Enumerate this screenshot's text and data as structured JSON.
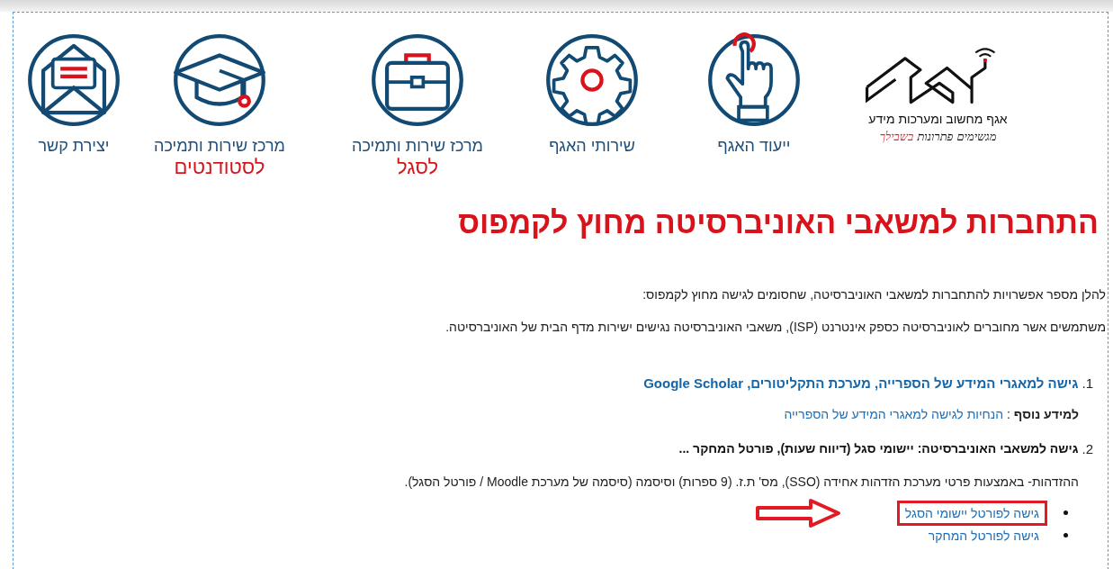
{
  "header": {
    "logo": {
      "name": "אגף מחשוב ומערכות מידע",
      "tagline": "מגשימים פתרונות",
      "tagline_highlight": "בשבילך"
    },
    "nav": [
      {
        "kind": "hand",
        "label": "ייעוד האגף"
      },
      {
        "kind": "gear",
        "label": "שירותי האגף"
      },
      {
        "kind": "briefcase",
        "label": "מרכז שירות ותמיכה",
        "sub": "לסגל"
      },
      {
        "kind": "cap",
        "label": "מרכז שירות ותמיכה",
        "sub": "לסטודנטים"
      },
      {
        "kind": "envelope",
        "label": "יצירת קשר"
      }
    ]
  },
  "title": "התחברות למשאבי האוניברסיטה מחוץ לקמפוס",
  "paragraphs": [
    "להלן מספר אפשרויות להתחברות למשאבי האוניברסיטה, שחסומים לגישה מחוץ לקמפוס:",
    "משתמשים אשר מחוברים לאוניברסיטה כספק אינטרנט (ISP), משאבי האוניברסיטה נגישים ישירות מדף הבית של האוניברסיטה."
  ],
  "sections": [
    {
      "number": "1.",
      "kind": "link",
      "heading": "גישה למאגרי המידע של הספרייה, מערכת התקליטורים, Google Scholar",
      "info_label": "למידע נוסף",
      "info_separator": ":",
      "info_link": "הנחיות לגישה למאגרי המידע של הספרייה"
    },
    {
      "number": "2.",
      "kind": "text",
      "heading": "גישה למשאבי האוניברסיטה: יישומי סגל (דיווח שעות), פורטל המחקר ...",
      "note": "ההזדהות- באמצעות פרטי מערכת הזדהות אחידה (SSO), מס' ת.ז. (9 ספרות) וסיסמה (סיסמה של מערכת Moodle / פורטל הסגל).",
      "bullets": [
        {
          "label": "גישה לפורטל יישומי הסגל",
          "highlighted": true
        },
        {
          "label": "גישה לפורטל המחקר",
          "highlighted": false
        }
      ]
    }
  ]
}
